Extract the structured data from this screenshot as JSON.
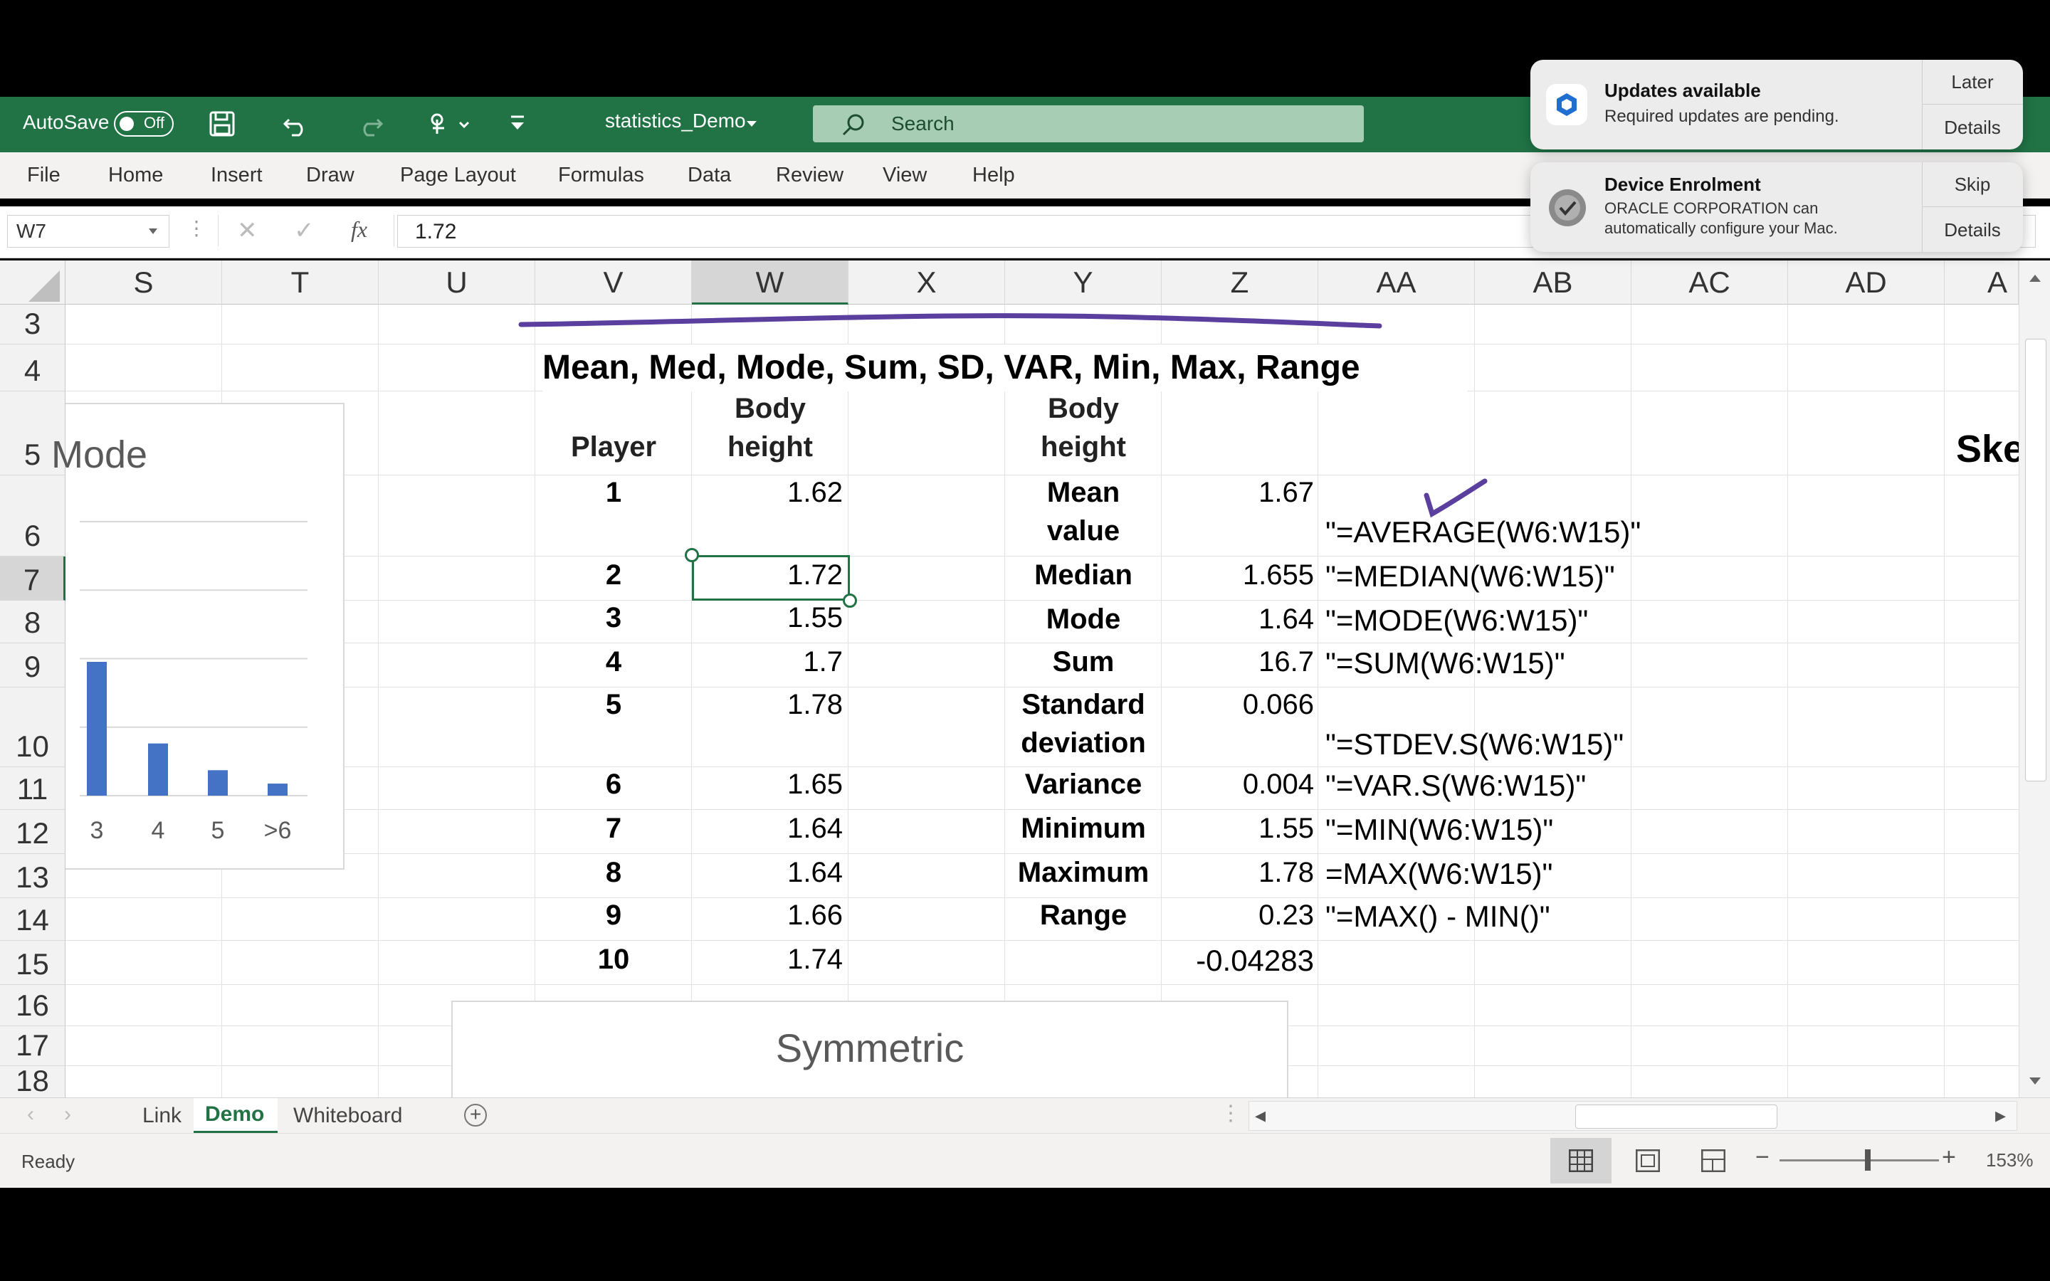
{
  "titlebar": {
    "autosave_label": "AutoSave",
    "autosave_state": "Off",
    "filename": "statistics_Demo",
    "search_placeholder": "Search"
  },
  "menu": [
    "File",
    "Home",
    "Insert",
    "Draw",
    "Page Layout",
    "Formulas",
    "Data",
    "Review",
    "View",
    "Help"
  ],
  "formula_bar": {
    "name_box": "W7",
    "fx": "fx",
    "value": "1.72"
  },
  "columns": [
    "S",
    "T",
    "U",
    "V",
    "W",
    "X",
    "Y",
    "Z",
    "AA",
    "AB",
    "AC",
    "AD",
    "A"
  ],
  "rows": [
    "3",
    "4",
    "5",
    "6",
    "7",
    "8",
    "9",
    "10",
    "11",
    "12",
    "13",
    "14",
    "15",
    "16",
    "17",
    "18"
  ],
  "sheet": {
    "title": "Mean, Med, Mode, Sum, SD, VAR, Min, Max, Range",
    "header_player": "Player",
    "header_body": "Body",
    "header_height": "height",
    "header2_body": "Body",
    "header2_height": "height",
    "skew_partial": "Ske",
    "players": [
      {
        "n": "1",
        "h": "1.62"
      },
      {
        "n": "2",
        "h": "1.72"
      },
      {
        "n": "3",
        "h": "1.55"
      },
      {
        "n": "4",
        "h": "1.7"
      },
      {
        "n": "5",
        "h": "1.78"
      },
      {
        "n": "6",
        "h": "1.65"
      },
      {
        "n": "7",
        "h": "1.64"
      },
      {
        "n": "8",
        "h": "1.64"
      },
      {
        "n": "9",
        "h": "1.66"
      },
      {
        "n": "10",
        "h": "1.74"
      }
    ],
    "stats": [
      {
        "label1": "Mean",
        "label2": "value",
        "value": "1.67",
        "formula": "\"=AVERAGE(W6:W15)\""
      },
      {
        "label1": "Median",
        "label2": "",
        "value": "1.655",
        "formula": "\"=MEDIAN(W6:W15)\""
      },
      {
        "label1": "Mode",
        "label2": "",
        "value": "1.64",
        "formula": "\"=MODE(W6:W15)\""
      },
      {
        "label1": "Sum",
        "label2": "",
        "value": "16.7",
        "formula": "\"=SUM(W6:W15)\""
      },
      {
        "label1": "Standard",
        "label2": "deviation",
        "value": "0.066",
        "formula": "\"=STDEV.S(W6:W15)\""
      },
      {
        "label1": "Variance",
        "label2": "",
        "value": "0.004",
        "formula": "\"=VAR.S(W6:W15)\""
      },
      {
        "label1": "Minimum",
        "label2": "",
        "value": "1.55",
        "formula": "\"=MIN(W6:W15)\""
      },
      {
        "label1": "Maximum",
        "label2": "",
        "value": "1.78",
        "formula": "=MAX(W6:W15)\""
      },
      {
        "label1": "Range",
        "label2": "",
        "value": "0.23",
        "formula": "\"=MAX() - MIN()\""
      }
    ],
    "z15": "-0.04283"
  },
  "chart_data": {
    "type": "bar",
    "title": "Mode",
    "categories": [
      "3",
      "4",
      "5",
      ">6"
    ],
    "values": [
      1.0,
      0.39,
      0.19,
      0.09
    ]
  },
  "symmetric_chart_title": "Symmetric",
  "sheet_tabs": [
    "Link",
    "Demo",
    "Whiteboard"
  ],
  "active_tab": "Demo",
  "status": {
    "ready": "Ready",
    "zoom": "153%"
  },
  "notifications": [
    {
      "title": "Updates available",
      "body": "Required updates are pending.",
      "btn1": "Later",
      "btn2": "Details"
    },
    {
      "title": "Device Enrolment",
      "body1": "ORACLE CORPORATION can",
      "body2": "automatically configure your Mac.",
      "btn1": "Skip",
      "btn2": "Details"
    }
  ],
  "colors": {
    "excel_green": "#217346",
    "bar_blue": "#4472c4",
    "ink_purple": "#5b3f9e"
  }
}
